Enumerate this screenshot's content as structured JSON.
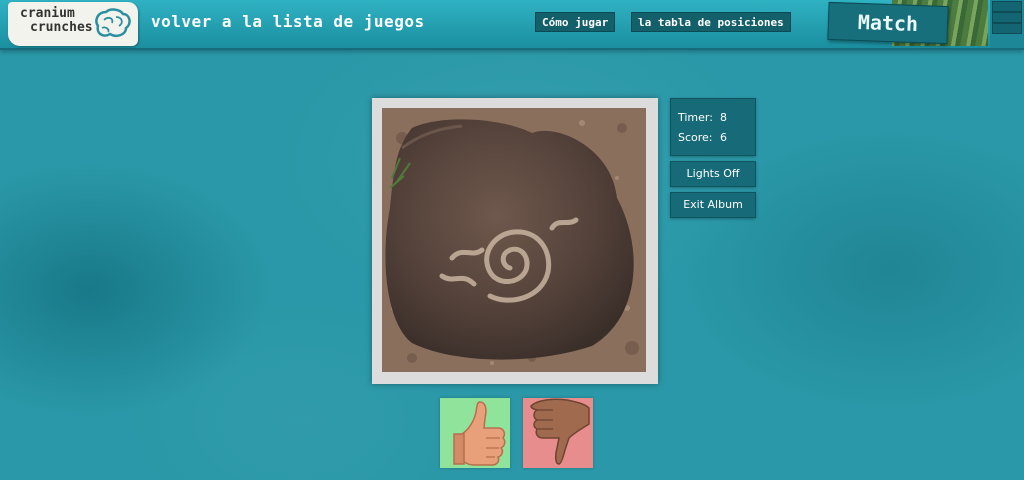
{
  "header": {
    "logo_line1": "cranium",
    "logo_line2": "crunches",
    "back_link": "volver a la lista de juegos",
    "how_to_play": "Cómo jugar",
    "leaderboard": "la tabla de posiciones",
    "game_tag": "Match"
  },
  "stats": {
    "timer_label": "Timer:",
    "timer_value": "8",
    "score_label": "Score:",
    "score_value": "6"
  },
  "actions": {
    "lights_off": "Lights Off",
    "exit_album": "Exit Album"
  },
  "vote": {
    "yes_icon": "thumbs-up-icon",
    "no_icon": "thumbs-down-icon",
    "yes_color": "#90e39a",
    "no_color": "#e88d8d"
  },
  "photo": {
    "subject_icon": "petroglyph-rock-photo"
  },
  "colors": {
    "background": "#2a98a8",
    "header": "#2fb2c3",
    "button": "#176a77"
  }
}
